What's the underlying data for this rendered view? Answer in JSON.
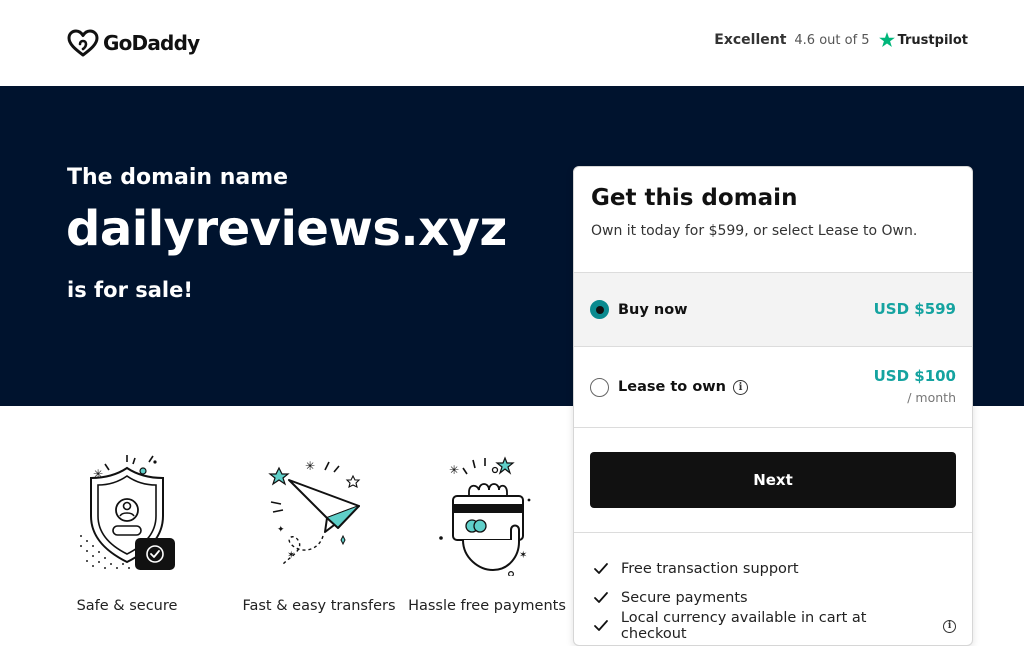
{
  "header": {
    "logo_text": "GoDaddy",
    "rating_label": "Excellent",
    "rating_score": "4.6 out of 5",
    "trustpilot_label": "Trustpilot"
  },
  "hero": {
    "intro": "The domain name",
    "domain": "dailyreviews.xyz",
    "sale": "is for sale!"
  },
  "features": [
    {
      "label": "Safe & secure",
      "icon": "shield-icon"
    },
    {
      "label": "Fast & easy transfers",
      "icon": "paper-plane-icon"
    },
    {
      "label": "Hassle free payments",
      "icon": "credit-card-icon"
    }
  ],
  "card": {
    "title": "Get this domain",
    "subtitle": "Own it today for $599, or select Lease to Own.",
    "options": [
      {
        "label": "Buy now",
        "price": "USD $599",
        "selected": true
      },
      {
        "label": "Lease to own",
        "price": "USD $100",
        "period": "/ month",
        "selected": false
      }
    ],
    "next_label": "Next",
    "benefits": [
      "Free transaction support",
      "Secure payments",
      "Local currency available in cart at checkout"
    ]
  },
  "colors": {
    "hero_bg": "#00132e",
    "accent": "#15a3a0",
    "button_bg": "#111111",
    "trustpilot_green": "#00b67a"
  }
}
